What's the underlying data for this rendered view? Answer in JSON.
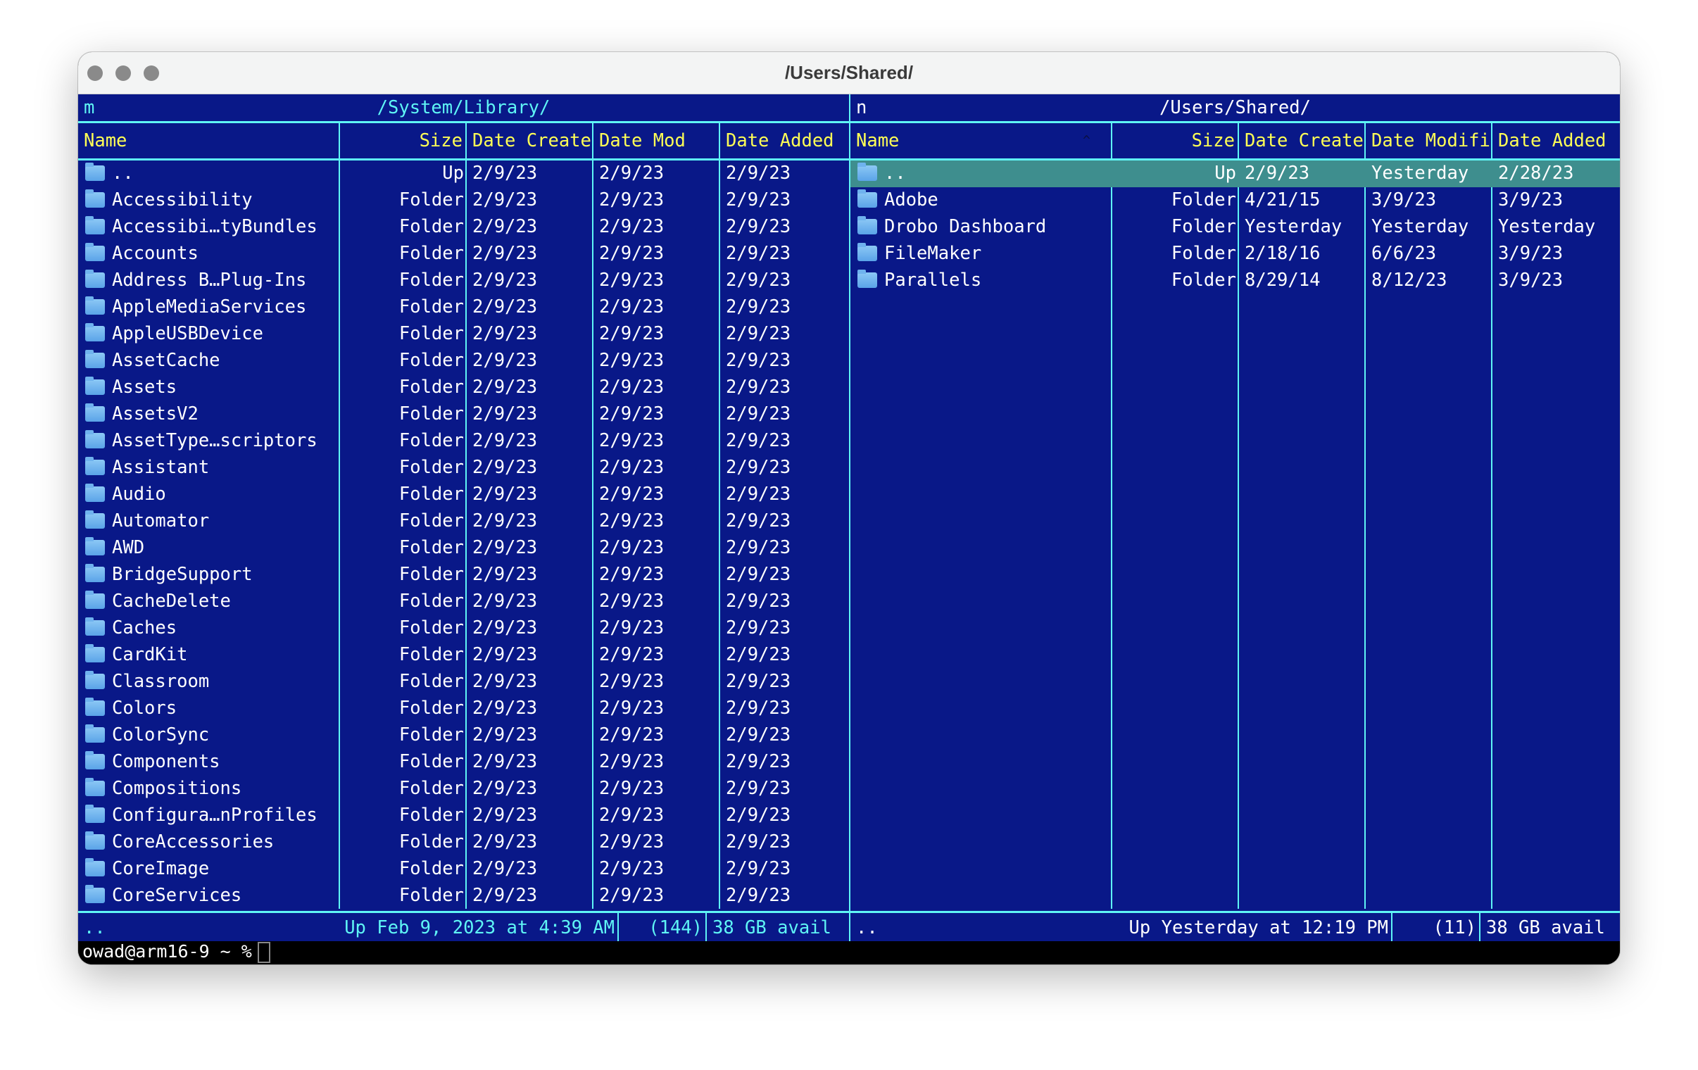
{
  "window": {
    "title": "/Users/Shared/"
  },
  "colors": {
    "background": "#091888",
    "border": "#5ff5f5",
    "header_text": "#ffff55",
    "selected_row": "#3e8e8e",
    "text": "#ffffff"
  },
  "left_panel": {
    "hotkey": "m",
    "path": "/System/Library/",
    "columns": [
      "Name",
      "Size",
      "Date Create",
      "Date Mod",
      "Date Added"
    ],
    "sort_indicator": "v",
    "rows": [
      [
        "..",
        "Up",
        "2/9/23",
        "2/9/23",
        "2/9/23"
      ],
      [
        "Accessibility",
        "Folder",
        "2/9/23",
        "2/9/23",
        "2/9/23"
      ],
      [
        "Accessibi…tyBundles",
        "Folder",
        "2/9/23",
        "2/9/23",
        "2/9/23"
      ],
      [
        "Accounts",
        "Folder",
        "2/9/23",
        "2/9/23",
        "2/9/23"
      ],
      [
        "Address B…Plug-Ins",
        "Folder",
        "2/9/23",
        "2/9/23",
        "2/9/23"
      ],
      [
        "AppleMediaServices",
        "Folder",
        "2/9/23",
        "2/9/23",
        "2/9/23"
      ],
      [
        "AppleUSBDevice",
        "Folder",
        "2/9/23",
        "2/9/23",
        "2/9/23"
      ],
      [
        "AssetCache",
        "Folder",
        "2/9/23",
        "2/9/23",
        "2/9/23"
      ],
      [
        "Assets",
        "Folder",
        "2/9/23",
        "2/9/23",
        "2/9/23"
      ],
      [
        "AssetsV2",
        "Folder",
        "2/9/23",
        "2/9/23",
        "2/9/23"
      ],
      [
        "AssetType…scriptors",
        "Folder",
        "2/9/23",
        "2/9/23",
        "2/9/23"
      ],
      [
        "Assistant",
        "Folder",
        "2/9/23",
        "2/9/23",
        "2/9/23"
      ],
      [
        "Audio",
        "Folder",
        "2/9/23",
        "2/9/23",
        "2/9/23"
      ],
      [
        "Automator",
        "Folder",
        "2/9/23",
        "2/9/23",
        "2/9/23"
      ],
      [
        "AWD",
        "Folder",
        "2/9/23",
        "2/9/23",
        "2/9/23"
      ],
      [
        "BridgeSupport",
        "Folder",
        "2/9/23",
        "2/9/23",
        "2/9/23"
      ],
      [
        "CacheDelete",
        "Folder",
        "2/9/23",
        "2/9/23",
        "2/9/23"
      ],
      [
        "Caches",
        "Folder",
        "2/9/23",
        "2/9/23",
        "2/9/23"
      ],
      [
        "CardKit",
        "Folder",
        "2/9/23",
        "2/9/23",
        "2/9/23"
      ],
      [
        "Classroom",
        "Folder",
        "2/9/23",
        "2/9/23",
        "2/9/23"
      ],
      [
        "Colors",
        "Folder",
        "2/9/23",
        "2/9/23",
        "2/9/23"
      ],
      [
        "ColorSync",
        "Folder",
        "2/9/23",
        "2/9/23",
        "2/9/23"
      ],
      [
        "Components",
        "Folder",
        "2/9/23",
        "2/9/23",
        "2/9/23"
      ],
      [
        "Compositions",
        "Folder",
        "2/9/23",
        "2/9/23",
        "2/9/23"
      ],
      [
        "Configura…nProfiles",
        "Folder",
        "2/9/23",
        "2/9/23",
        "2/9/23"
      ],
      [
        "CoreAccessories",
        "Folder",
        "2/9/23",
        "2/9/23",
        "2/9/23"
      ],
      [
        "CoreImage",
        "Folder",
        "2/9/23",
        "2/9/23",
        "2/9/23"
      ],
      [
        "CoreServices",
        "Folder",
        "2/9/23",
        "2/9/23",
        "2/9/23"
      ]
    ],
    "status": {
      "name": "..",
      "info": "Up Feb 9, 2023 at 4:39 AM",
      "count": "(144)",
      "avail": "38 GB avail"
    }
  },
  "right_panel": {
    "hotkey": "n",
    "path": "/Users/Shared/",
    "columns": [
      "Name",
      "Size",
      "Date Create",
      "Date Modifi",
      "Date Added"
    ],
    "sort_indicator": "^",
    "rows": [
      [
        "..",
        "Up",
        "2/9/23",
        "Yesterday",
        "2/28/23"
      ],
      [
        "Adobe",
        "Folder",
        "4/21/15",
        "3/9/23",
        "3/9/23"
      ],
      [
        "Drobo Dashboard",
        "Folder",
        "Yesterday",
        "Yesterday",
        "Yesterday"
      ],
      [
        "FileMaker",
        "Folder",
        "2/18/16",
        "6/6/23",
        "3/9/23"
      ],
      [
        "Parallels",
        "Folder",
        "8/29/14",
        "8/12/23",
        "3/9/23"
      ]
    ],
    "selected_index": 0,
    "status": {
      "name": "..",
      "info": "Up Yesterday at 12:19 PM",
      "count": "(11)",
      "avail": "38 GB avail"
    }
  },
  "terminal": {
    "prompt": "owad@arm16-9 ~ %"
  }
}
